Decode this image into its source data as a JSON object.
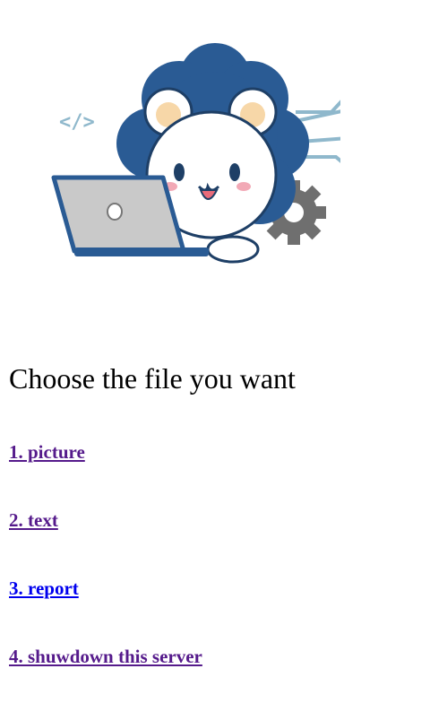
{
  "page": {
    "heading": "Choose the file you want"
  },
  "links": [
    {
      "label": "1. picture",
      "state": "visited"
    },
    {
      "label": "2. text",
      "state": "visited"
    },
    {
      "label": "3. report",
      "state": "unvisited"
    },
    {
      "label": "4. shuwdown this server",
      "state": "visited"
    }
  ],
  "colors": {
    "visited_link": "#551a8b",
    "unvisited_link": "#0000ee",
    "mascot_blue": "#2a5b94",
    "circuit_blue": "#8fb8cc"
  },
  "illustration": {
    "icon": "mascot-coding-laptop-icon",
    "code_tag": "</>"
  }
}
